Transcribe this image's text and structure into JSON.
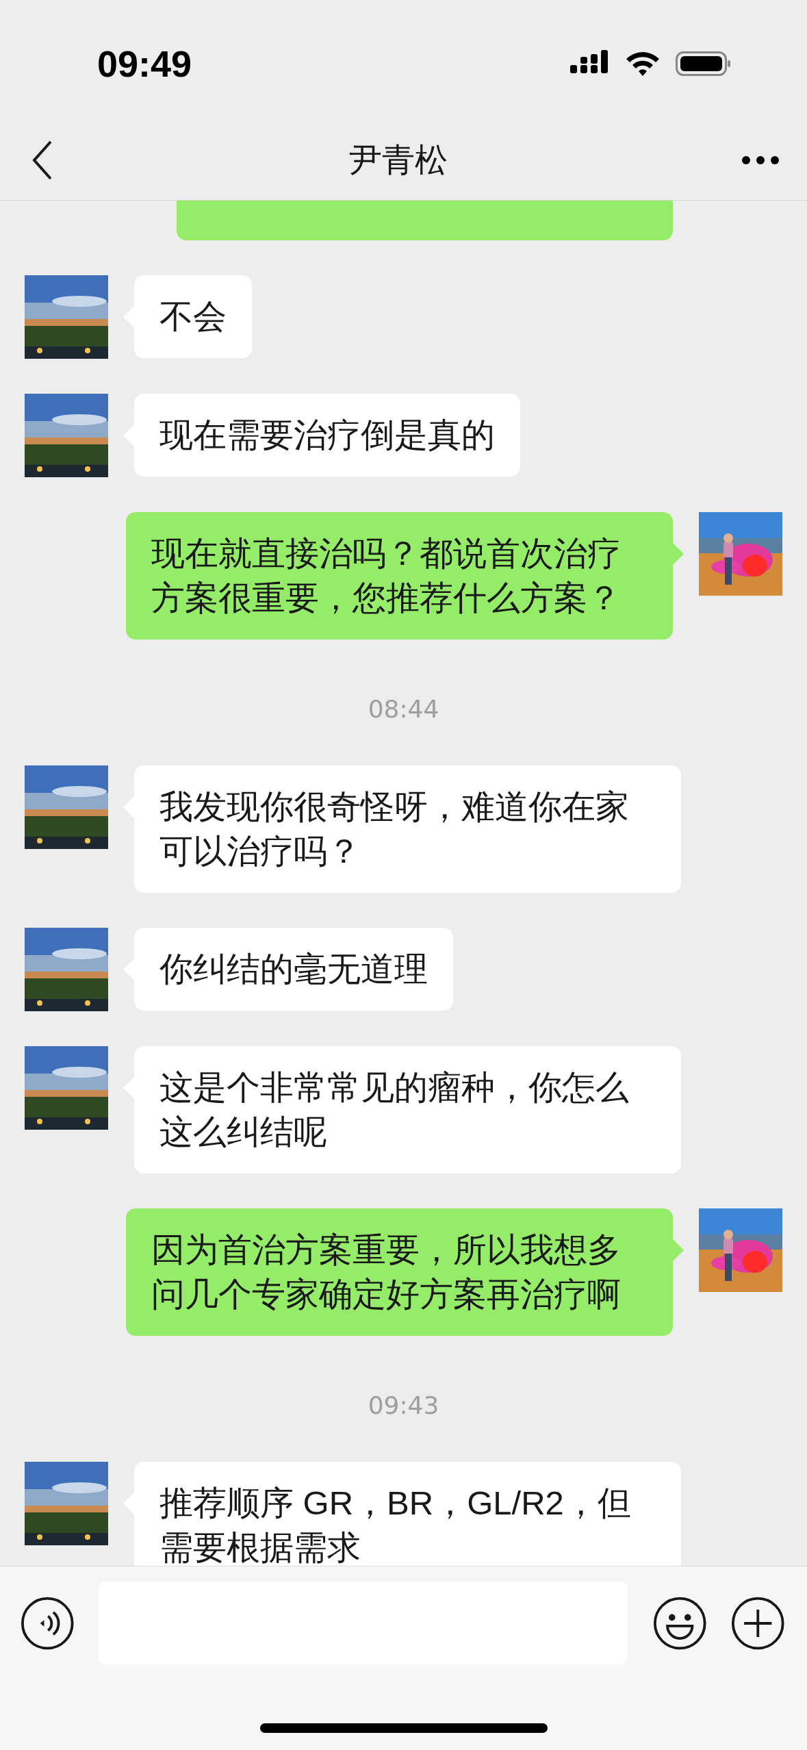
{
  "status_bar": {
    "time": "09:49"
  },
  "header": {
    "title": "尹青松"
  },
  "messages": [
    {
      "kind": "partial",
      "outgoing": true
    },
    {
      "kind": "text",
      "outgoing": false,
      "text": "不会"
    },
    {
      "kind": "text",
      "outgoing": false,
      "text": "现在需要治疗倒是真的"
    },
    {
      "kind": "text",
      "outgoing": true,
      "text": "现在就直接治吗？都说首次治疗方案很重要，您推荐什么方案？"
    },
    {
      "kind": "time",
      "text": "08:44"
    },
    {
      "kind": "text",
      "outgoing": false,
      "text": "我发现你很奇怪呀，难道你在家可以治疗吗？"
    },
    {
      "kind": "text",
      "outgoing": false,
      "text": "你纠结的毫无道理"
    },
    {
      "kind": "text",
      "outgoing": false,
      "text": "这是个非常常见的瘤种，你怎么这么纠结呢"
    },
    {
      "kind": "text",
      "outgoing": true,
      "text": "因为首治方案重要，所以我想多问几个专家确定好方案再治疗啊"
    },
    {
      "kind": "time",
      "text": "09:43"
    },
    {
      "kind": "text",
      "outgoing": false,
      "text": "推荐顺序 GR，BR，GL/R2，但需要根据需求"
    }
  ]
}
